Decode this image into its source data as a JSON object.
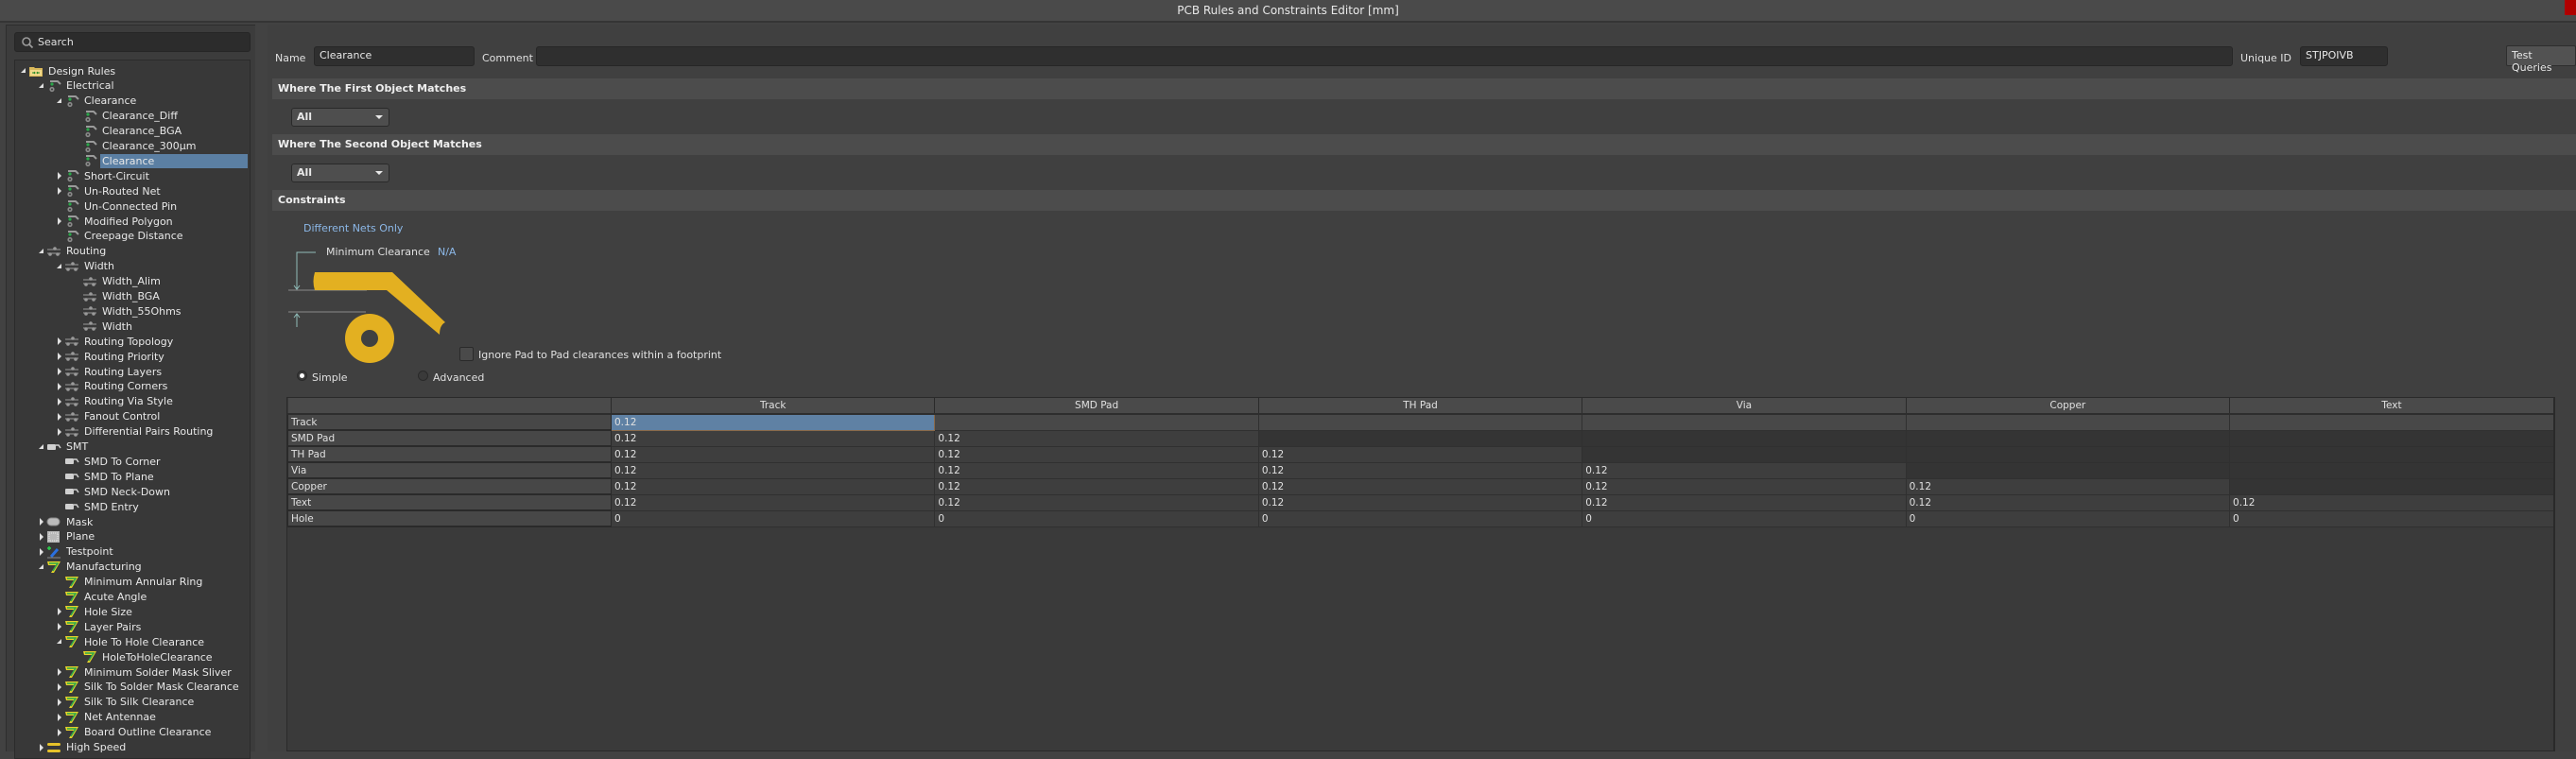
{
  "window": {
    "title": "PCB Rules and Constraints Editor [mm]"
  },
  "search": {
    "placeholder": "Search",
    "value": ""
  },
  "tree": [
    {
      "label": "Design Rules",
      "level": 0,
      "expander": "open",
      "icon": "folder-rules-icon"
    },
    {
      "label": "Electrical",
      "level": 1,
      "expander": "open",
      "icon": "electrical-rule-icon"
    },
    {
      "label": "Clearance",
      "level": 2,
      "expander": "open",
      "icon": "electrical-rule-icon"
    },
    {
      "label": "Clearance_Diff",
      "level": 3,
      "expander": "none",
      "icon": "electrical-rule-icon"
    },
    {
      "label": "Clearance_BGA",
      "level": 3,
      "expander": "none",
      "icon": "electrical-rule-icon"
    },
    {
      "label": "Clearance_300µm",
      "level": 3,
      "expander": "none",
      "icon": "electrical-rule-icon"
    },
    {
      "label": "Clearance",
      "level": 3,
      "expander": "none",
      "icon": "electrical-rule-icon",
      "selected": true
    },
    {
      "label": "Short-Circuit",
      "level": 2,
      "expander": "closed",
      "icon": "electrical-rule-icon"
    },
    {
      "label": "Un-Routed Net",
      "level": 2,
      "expander": "closed",
      "icon": "electrical-rule-icon"
    },
    {
      "label": "Un-Connected Pin",
      "level": 2,
      "expander": "none",
      "icon": "electrical-rule-icon"
    },
    {
      "label": "Modified Polygon",
      "level": 2,
      "expander": "closed",
      "icon": "electrical-rule-icon"
    },
    {
      "label": "Creepage Distance",
      "level": 2,
      "expander": "none",
      "icon": "electrical-rule-icon"
    },
    {
      "label": "Routing",
      "level": 1,
      "expander": "open",
      "icon": "routing-rule-icon"
    },
    {
      "label": "Width",
      "level": 2,
      "expander": "open",
      "icon": "routing-rule-icon"
    },
    {
      "label": "Width_Alim",
      "level": 3,
      "expander": "none",
      "icon": "routing-rule-icon"
    },
    {
      "label": "Width_BGA",
      "level": 3,
      "expander": "none",
      "icon": "routing-rule-icon"
    },
    {
      "label": "Width_55Ohms",
      "level": 3,
      "expander": "none",
      "icon": "routing-rule-icon"
    },
    {
      "label": "Width",
      "level": 3,
      "expander": "none",
      "icon": "routing-rule-icon"
    },
    {
      "label": "Routing Topology",
      "level": 2,
      "expander": "closed",
      "icon": "routing-rule-icon"
    },
    {
      "label": "Routing Priority",
      "level": 2,
      "expander": "closed",
      "icon": "routing-rule-icon"
    },
    {
      "label": "Routing Layers",
      "level": 2,
      "expander": "closed",
      "icon": "routing-rule-icon"
    },
    {
      "label": "Routing Corners",
      "level": 2,
      "expander": "closed",
      "icon": "routing-rule-icon"
    },
    {
      "label": "Routing Via Style",
      "level": 2,
      "expander": "closed",
      "icon": "routing-rule-icon"
    },
    {
      "label": "Fanout Control",
      "level": 2,
      "expander": "closed",
      "icon": "routing-rule-icon"
    },
    {
      "label": "Differential Pairs Routing",
      "level": 2,
      "expander": "closed",
      "icon": "routing-rule-icon"
    },
    {
      "label": "SMT",
      "level": 1,
      "expander": "open",
      "icon": "smt-rule-icon"
    },
    {
      "label": "SMD To Corner",
      "level": 2,
      "expander": "none",
      "icon": "smt-rule-icon"
    },
    {
      "label": "SMD To Plane",
      "level": 2,
      "expander": "none",
      "icon": "smt-rule-icon"
    },
    {
      "label": "SMD Neck-Down",
      "level": 2,
      "expander": "none",
      "icon": "smt-rule-icon"
    },
    {
      "label": "SMD Entry",
      "level": 2,
      "expander": "none",
      "icon": "smt-rule-icon"
    },
    {
      "label": "Mask",
      "level": 1,
      "expander": "closed",
      "icon": "mask-rule-icon"
    },
    {
      "label": "Plane",
      "level": 1,
      "expander": "closed",
      "icon": "plane-rule-icon"
    },
    {
      "label": "Testpoint",
      "level": 1,
      "expander": "closed",
      "icon": "testpoint-rule-icon"
    },
    {
      "label": "Manufacturing",
      "level": 1,
      "expander": "open",
      "icon": "manufacturing-rule-icon"
    },
    {
      "label": "Minimum Annular Ring",
      "level": 2,
      "expander": "none",
      "icon": "manufacturing-rule-icon"
    },
    {
      "label": "Acute Angle",
      "level": 2,
      "expander": "none",
      "icon": "manufacturing-rule-icon"
    },
    {
      "label": "Hole Size",
      "level": 2,
      "expander": "closed",
      "icon": "manufacturing-rule-icon"
    },
    {
      "label": "Layer Pairs",
      "level": 2,
      "expander": "closed",
      "icon": "manufacturing-rule-icon"
    },
    {
      "label": "Hole To Hole Clearance",
      "level": 2,
      "expander": "open",
      "icon": "manufacturing-rule-icon"
    },
    {
      "label": "HoleToHoleClearance",
      "level": 3,
      "expander": "none",
      "icon": "manufacturing-rule-icon"
    },
    {
      "label": "Minimum Solder Mask Sliver",
      "level": 2,
      "expander": "closed",
      "icon": "manufacturing-rule-icon"
    },
    {
      "label": "Silk To Solder Mask Clearance",
      "level": 2,
      "expander": "closed",
      "icon": "manufacturing-rule-icon"
    },
    {
      "label": "Silk To Silk Clearance",
      "level": 2,
      "expander": "closed",
      "icon": "manufacturing-rule-icon"
    },
    {
      "label": "Net Antennae",
      "level": 2,
      "expander": "closed",
      "icon": "manufacturing-rule-icon"
    },
    {
      "label": "Board Outline Clearance",
      "level": 2,
      "expander": "closed",
      "icon": "manufacturing-rule-icon"
    },
    {
      "label": "High Speed",
      "level": 1,
      "expander": "closed",
      "icon": "highspeed-rule-icon"
    }
  ],
  "rule": {
    "name_label": "Name",
    "name_value": "Clearance",
    "comment_label": "Comment",
    "comment_value": "",
    "uid_label": "Unique ID",
    "uid_value": "STJPOIVB",
    "test_queries_label": "Test Queries"
  },
  "first_match": {
    "heading": "Where The First Object Matches",
    "value": "All"
  },
  "second_match": {
    "heading": "Where The Second Object Matches",
    "value": "All"
  },
  "constraints": {
    "heading": "Constraints",
    "net_scope": "Different Nets Only",
    "min_clearance_label": "Minimum Clearance",
    "min_clearance_value": "N/A",
    "ignore_pad_label": "Ignore Pad to Pad clearances within a footprint",
    "ignore_pad_checked": false,
    "mode_simple_label": "Simple",
    "mode_advanced_label": "Advanced",
    "mode": "Simple",
    "accent_color": "#e3b021"
  },
  "grid": {
    "columns": [
      "Track",
      "SMD Pad",
      "TH Pad",
      "Via",
      "Copper",
      "Text"
    ],
    "rows": [
      {
        "label": "Track",
        "values": [
          "0.12"
        ]
      },
      {
        "label": "SMD Pad",
        "values": [
          "0.12",
          "0.12"
        ]
      },
      {
        "label": "TH Pad",
        "values": [
          "0.12",
          "0.12",
          "0.12"
        ]
      },
      {
        "label": "Via",
        "values": [
          "0.12",
          "0.12",
          "0.12",
          "0.12"
        ]
      },
      {
        "label": "Copper",
        "values": [
          "0.12",
          "0.12",
          "0.12",
          "0.12",
          "0.12"
        ]
      },
      {
        "label": "Text",
        "values": [
          "0.12",
          "0.12",
          "0.12",
          "0.12",
          "0.12",
          "0.12"
        ]
      },
      {
        "label": "Hole",
        "values": [
          "0",
          "0",
          "0",
          "0",
          "0",
          "0"
        ]
      }
    ],
    "selected_cell": {
      "row": 0,
      "col": 0
    }
  }
}
